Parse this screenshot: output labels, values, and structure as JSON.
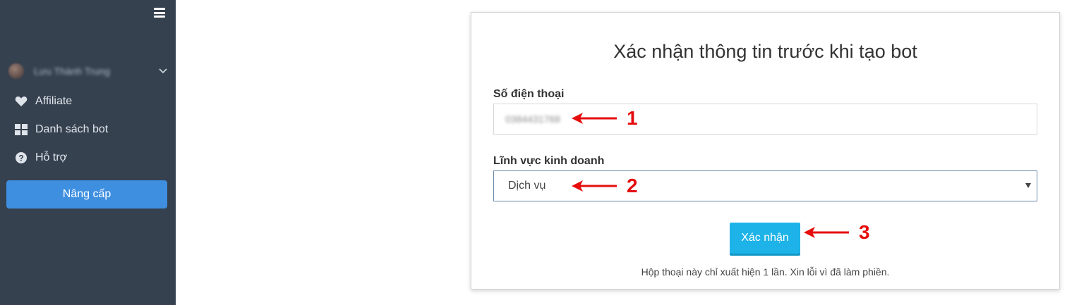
{
  "sidebar": {
    "user_name": "Lưu Thành Trung",
    "items": [
      {
        "label": "Affiliate",
        "icon": "heart-icon"
      },
      {
        "label": "Danh sách bot",
        "icon": "grid-icon"
      },
      {
        "label": "Hỗ trợ",
        "icon": "question-circle-icon"
      }
    ],
    "upgrade_label": "Nâng cấp"
  },
  "modal": {
    "title": "Xác nhận thông tin trước khi tạo bot",
    "phone_label": "Số điện thoại",
    "phone_value": "0384431768",
    "field_label": "Lĩnh vực kinh doanh",
    "field_value": "Dịch vụ",
    "confirm_label": "Xác nhận",
    "note": "Hộp thoại này chỉ xuất hiện 1 lần. Xin lỗi vì đã làm phiền."
  },
  "annotations": [
    "1",
    "2",
    "3"
  ],
  "colors": {
    "sidebar_bg": "#364150",
    "upgrade_button": "#3e8fe0",
    "confirm_button": "#1eb3e8",
    "annotation_red": "#e60d0d"
  }
}
